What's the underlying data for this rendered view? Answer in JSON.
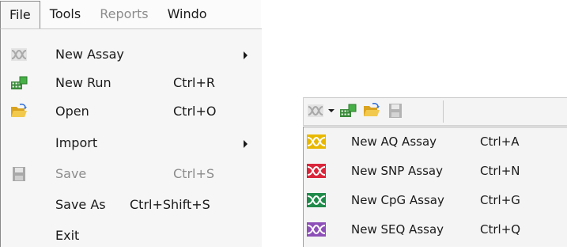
{
  "menubar": {
    "items": [
      {
        "label": "File",
        "state": "open"
      },
      {
        "label": "Tools",
        "state": "normal"
      },
      {
        "label": "Reports",
        "state": "disabled"
      },
      {
        "label": "Windo",
        "state": "normal"
      }
    ]
  },
  "file_menu": {
    "items": [
      {
        "label": "New Assay",
        "shortcut": "",
        "submenu": true,
        "icon": "assay-wave-icon",
        "enabled": true
      },
      {
        "label": "New Run",
        "shortcut": "Ctrl+R",
        "submenu": false,
        "icon": "new-run-icon",
        "enabled": true
      },
      {
        "label": "Open",
        "shortcut": "Ctrl+O",
        "submenu": false,
        "icon": "folder-open-icon",
        "enabled": true
      },
      {
        "label": "Import",
        "shortcut": "",
        "submenu": true,
        "icon": "",
        "enabled": true
      },
      {
        "label": "Save",
        "shortcut": "Ctrl+S",
        "submenu": false,
        "icon": "save-disk-icon",
        "enabled": false
      },
      {
        "label": "Save As",
        "shortcut": "Ctrl+Shift+S",
        "submenu": false,
        "icon": "",
        "enabled": true
      },
      {
        "label": "Exit",
        "shortcut": "",
        "submenu": false,
        "icon": "",
        "enabled": true
      }
    ]
  },
  "toolbar": {
    "buttons": [
      "assay-wave-icon",
      "dropdown-arrow-icon",
      "new-run-icon",
      "folder-open-icon",
      "save-disk-icon"
    ]
  },
  "assay_dropdown": {
    "items": [
      {
        "label": "New AQ Assay",
        "shortcut": "Ctrl+A",
        "color": "#e8b800"
      },
      {
        "label": "New SNP Assay",
        "shortcut": "Ctrl+N",
        "color": "#d9263b"
      },
      {
        "label": "New CpG Assay",
        "shortcut": "Ctrl+G",
        "color": "#1f8a4a"
      },
      {
        "label": "New SEQ Assay",
        "shortcut": "Ctrl+Q",
        "color": "#8d4fb8"
      }
    ]
  },
  "colors": {
    "menu_bg": "#f6f6f6",
    "disabled_text": "#8c8c8c",
    "assay_icon_gray": "#b5b5b5"
  }
}
